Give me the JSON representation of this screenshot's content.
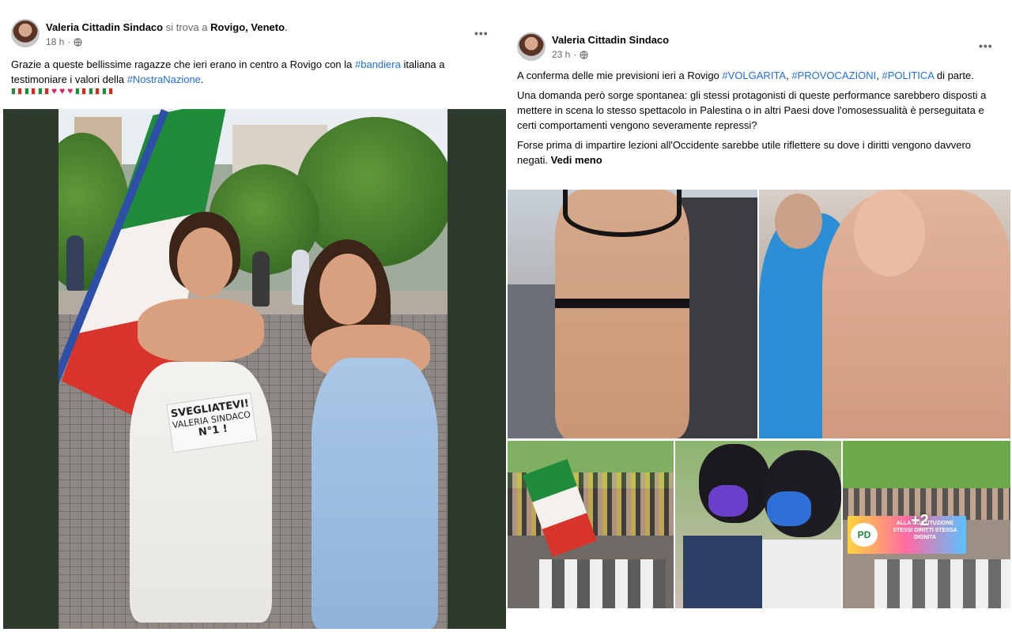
{
  "left_post": {
    "author": "Valeria Cittadin Sindaco",
    "checkin_connector": "si trova a",
    "location": "Rovigo, Veneto",
    "location_suffix": ".",
    "time": "18 h",
    "more_label": "•••",
    "text": {
      "p1": "Grazie a queste bellissime ragazze che ieri erano in centro a Rovigo con la ",
      "tag1": "#bandiera",
      "p2": "  italiana a testimoniare i valori della ",
      "tag2": "#NostraNazione",
      "p3": "."
    },
    "emoji_row": [
      "flag",
      "flag",
      "flag",
      "heart",
      "heart",
      "heart",
      "flag",
      "flag",
      "flag"
    ],
    "photo": {
      "sign_line1": "SVEGLIATEVI!",
      "sign_line2": "VALERIA SINDACO",
      "sign_line3": "N°1 !"
    }
  },
  "right_post": {
    "author": "Valeria Cittadin Sindaco",
    "time": "23 h",
    "more_label": "•••",
    "text": {
      "p1": "A conferma delle mie previsioni ieri a Rovigo  ",
      "tag1": "#VOLGARITA",
      "sep1": ", ",
      "tag2": "#PROVOCAZIONI",
      "sep2": ", ",
      "tag3": "#POLITICA",
      "p1_end": " di parte.",
      "p2": "Una domanda però sorge spontanea: gli stessi protagonisti di queste performance sarebbero disposti a mettere in scena lo stesso spettacolo in Palestina o in altri Paesi dove l'omosessualità è perseguitata e certi comportamenti vengono severamente repressi?",
      "p3": "Forse prima di impartire lezioni all'Occidente sarebbe utile riflettere su dove i diritti vengono davvero negati. ",
      "see_less": "Vedi meno"
    },
    "more_photos": "+2",
    "banner_text": "ALLA COSTITUZIONE STESSI DIRITTI STESSA DIGNITA",
    "pd_logo": "PD"
  },
  "colors": {
    "hashtag": "#216fdb",
    "muted": "#65676b",
    "flag_green": "#1e8c3a",
    "flag_red": "#d52b1e"
  }
}
